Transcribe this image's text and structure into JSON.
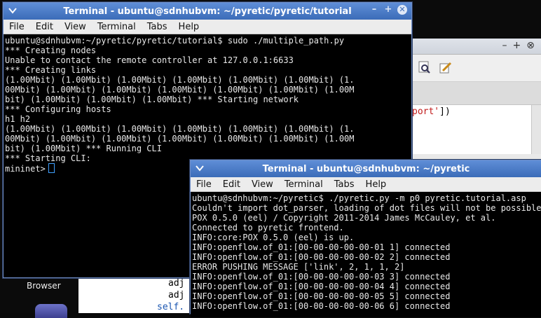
{
  "dock": {
    "browser_label": "Browser"
  },
  "editor": {
    "code_fragment_prefix": "",
    "code_fragment_string": "port'",
    "code_fragment_suffix": "])",
    "lower_lines": [
      "adj",
      "adj",
      "self."
    ]
  },
  "terminal1": {
    "title": "Terminal - ubuntu@sdnhubvm: ~/pyretic/pyretic/tutorial",
    "menu": [
      "File",
      "Edit",
      "View",
      "Terminal",
      "Tabs",
      "Help"
    ],
    "lines": [
      "ubuntu@sdnhubvm:~/pyretic/pyretic/tutorial$ sudo ./multiple_path.py",
      "*** Creating nodes",
      "Unable to contact the remote controller at 127.0.0.1:6633",
      "*** Creating links",
      "(1.00Mbit) (1.00Mbit) (1.00Mbit) (1.00Mbit) (1.00Mbit) (1.00Mbit) (1.",
      "00Mbit) (1.00Mbit) (1.00Mbit) (1.00Mbit) (1.00Mbit) (1.00Mbit) (1.00M",
      "bit) (1.00Mbit) (1.00Mbit) (1.00Mbit) *** Starting network",
      "*** Configuring hosts",
      "h1 h2",
      "(1.00Mbit) (1.00Mbit) (1.00Mbit) (1.00Mbit) (1.00Mbit) (1.00Mbit) (1.",
      "00Mbit) (1.00Mbit) (1.00Mbit) (1.00Mbit) (1.00Mbit) (1.00Mbit) (1.00M",
      "bit) (1.00Mbit) *** Running CLI",
      "*** Starting CLI:"
    ],
    "prompt": "mininet>"
  },
  "terminal2": {
    "title": "Terminal - ubuntu@sdnhubvm: ~/pyretic",
    "menu": [
      "File",
      "Edit",
      "View",
      "Terminal",
      "Tabs",
      "Help"
    ],
    "lines": [
      "ubuntu@sdnhubvm:~/pyretic$ ./pyretic.py -m p0 pyretic.tutorial.asp",
      "Couldn't import dot_parser, loading of dot files will not be possible.",
      "POX 0.5.0 (eel) / Copyright 2011-2014 James McCauley, et al.",
      "Connected to pyretic frontend.",
      "INFO:core:POX 0.5.0 (eel) is up.",
      "INFO:openflow.of_01:[00-00-00-00-00-01 1] connected",
      "INFO:openflow.of_01:[00-00-00-00-00-02 2] connected",
      "ERROR PUSHING MESSAGE ['link', 2, 1, 1, 2]",
      "INFO:openflow.of_01:[00-00-00-00-00-03 3] connected",
      "INFO:openflow.of_01:[00-00-00-00-00-04 4] connected",
      "INFO:openflow.of_01:[00-00-00-00-00-05 5] connected",
      "INFO:openflow.of_01:[00-00-00-00-00-06 6] connected"
    ]
  }
}
